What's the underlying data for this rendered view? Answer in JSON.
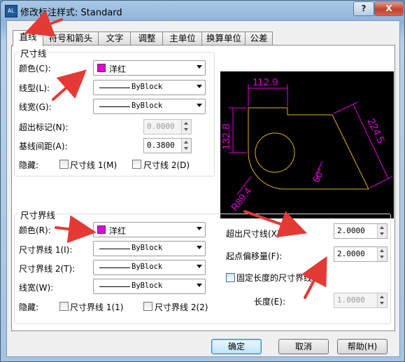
{
  "window": {
    "title": "修改标注样式: Standard",
    "icon_text": "AL"
  },
  "caption_buttons": {
    "help": "?",
    "close": "X"
  },
  "tabs": [
    "直线",
    "符号和箭头",
    "文字",
    "调整",
    "主单位",
    "换算单位",
    "公差"
  ],
  "dim_lines": {
    "group_title": "尺寸线",
    "color_label": "颜色(C):",
    "color_value": "洋红",
    "linetype_label": "线型(L):",
    "linetype_value": "ByBlock",
    "lineweight_label": "线宽(G):",
    "lineweight_value": "ByBlock",
    "extend_ticks_label": "超出标记(N):",
    "extend_ticks_value": "0.0000",
    "baseline_spacing_label": "基线间距(A):",
    "baseline_spacing_value": "0.3800",
    "suppress_label": "隐藏:",
    "suppress_1": "尺寸线 1(M)",
    "suppress_2": "尺寸线 2(D)"
  },
  "ext_lines": {
    "group_title": "尺寸界线",
    "color_label": "颜色(R):",
    "color_value": "洋红",
    "ext1_linetype_label": "尺寸界线 1(I):",
    "ext1_linetype_value": "ByBlock",
    "ext2_linetype_label": "尺寸界线 2(T):",
    "ext2_linetype_value": "ByBlock",
    "lineweight_label": "线宽(W):",
    "lineweight_value": "ByBlock",
    "suppress_label": "隐藏:",
    "suppress_1": "尺寸界线 1(1)",
    "suppress_2": "尺寸界线 2(2)",
    "extend_beyond_label": "超出尺寸线(X):",
    "extend_beyond_value": "2.0000",
    "offset_label": "起点偏移量(F):",
    "offset_value": "2.0000",
    "fixed_length_label": "固定长度的尺寸界线(O)",
    "length_label": "长度(E):",
    "length_value": "1.0000"
  },
  "preview": {
    "dim_top": "112.9",
    "dim_left": "132.8",
    "dim_right": "224.5",
    "dim_angle": "60°",
    "dim_radius": "R89.4"
  },
  "buttons": {
    "ok": "确定",
    "cancel": "取消",
    "help": "帮助(H)"
  },
  "colors": {
    "magenta": "#e000e0",
    "annotation_red": "#e53935",
    "dimension": "#e000e0",
    "geometry": "#e0b020"
  }
}
